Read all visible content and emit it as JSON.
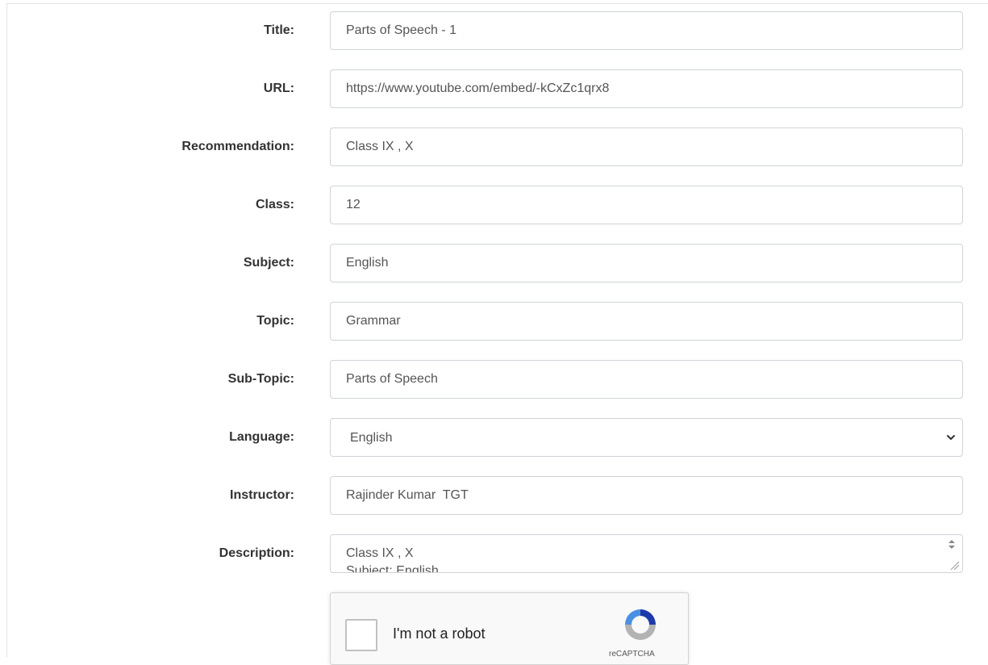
{
  "form": {
    "title": {
      "label": "Title:",
      "value": "Parts of Speech - 1"
    },
    "url": {
      "label": "URL:",
      "value": "https://www.youtube.com/embed/-kCxZc1qrx8"
    },
    "recommendation": {
      "label": "Recommendation:",
      "value": "Class IX , X"
    },
    "class": {
      "label": "Class:",
      "value": "12"
    },
    "subject": {
      "label": "Subject:",
      "value": "English"
    },
    "topic": {
      "label": "Topic:",
      "value": "Grammar"
    },
    "subtopic": {
      "label": "Sub-Topic:",
      "value": "Parts of Speech"
    },
    "language": {
      "label": "Language:",
      "selected": "English"
    },
    "instructor": {
      "label": "Instructor:",
      "value": "Rajinder Kumar  TGT"
    },
    "description": {
      "label": "Description:",
      "value": "Class IX , X\nSubject: English"
    }
  },
  "captcha": {
    "label": "I'm not a robot",
    "brand": "reCAPTCHA",
    "colors": {
      "blue": "#4a90e2",
      "gray": "#b3b3b3",
      "dark_blue": "#1c3aa9"
    }
  },
  "icons": {
    "dropdown": "chevron-down-icon",
    "recaptcha": "recaptcha-logo-icon",
    "resize": "resize-handle-icon"
  }
}
